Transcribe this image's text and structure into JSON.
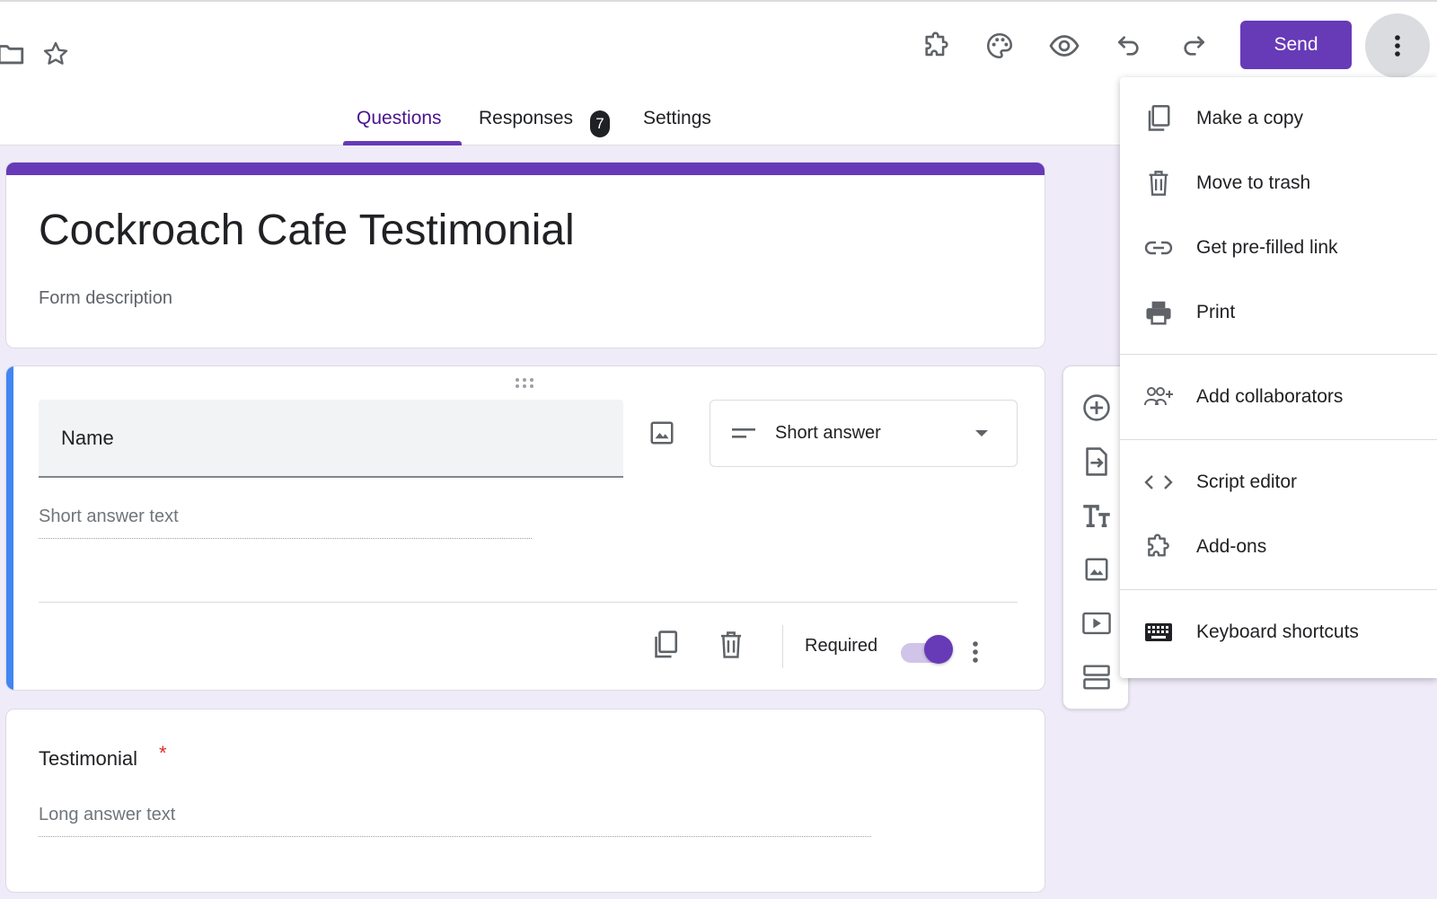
{
  "header": {
    "send_label": "Send",
    "icons": [
      "folder-icon",
      "star-icon",
      "addon-icon",
      "palette-icon",
      "preview-icon",
      "undo-icon",
      "redo-icon",
      "more-vert-icon"
    ]
  },
  "tabs": [
    {
      "label": "Questions",
      "active": true
    },
    {
      "label": "Responses",
      "badge": "7"
    },
    {
      "label": "Settings"
    }
  ],
  "form": {
    "title": "Cockroach Cafe Testimonial",
    "description_placeholder": "Form description"
  },
  "question1": {
    "title": "Name",
    "type": "Short answer",
    "answer_placeholder": "Short answer text",
    "required_label": "Required",
    "required": true
  },
  "question2": {
    "title": "Testimonial",
    "required_mark": "*",
    "answer_placeholder": "Long answer text"
  },
  "menu": {
    "items": [
      {
        "label": "Make a copy",
        "icon": "copy-icon"
      },
      {
        "label": "Move to trash",
        "icon": "trash-icon"
      },
      {
        "label": "Get pre-filled link",
        "icon": "link-icon"
      },
      {
        "label": "Print",
        "icon": "print-icon"
      },
      {
        "label": "Add collaborators",
        "icon": "collaborators-icon"
      },
      {
        "label": "Script editor",
        "icon": "code-icon"
      },
      {
        "label": "Add-ons",
        "icon": "addon-icon"
      },
      {
        "label": "Keyboard shortcuts",
        "icon": "keyboard-icon"
      }
    ]
  },
  "colors": {
    "accent": "#673ab7",
    "background": "#f0ebf8",
    "active_question_bar": "#4285f4",
    "required_star": "#d93025"
  }
}
